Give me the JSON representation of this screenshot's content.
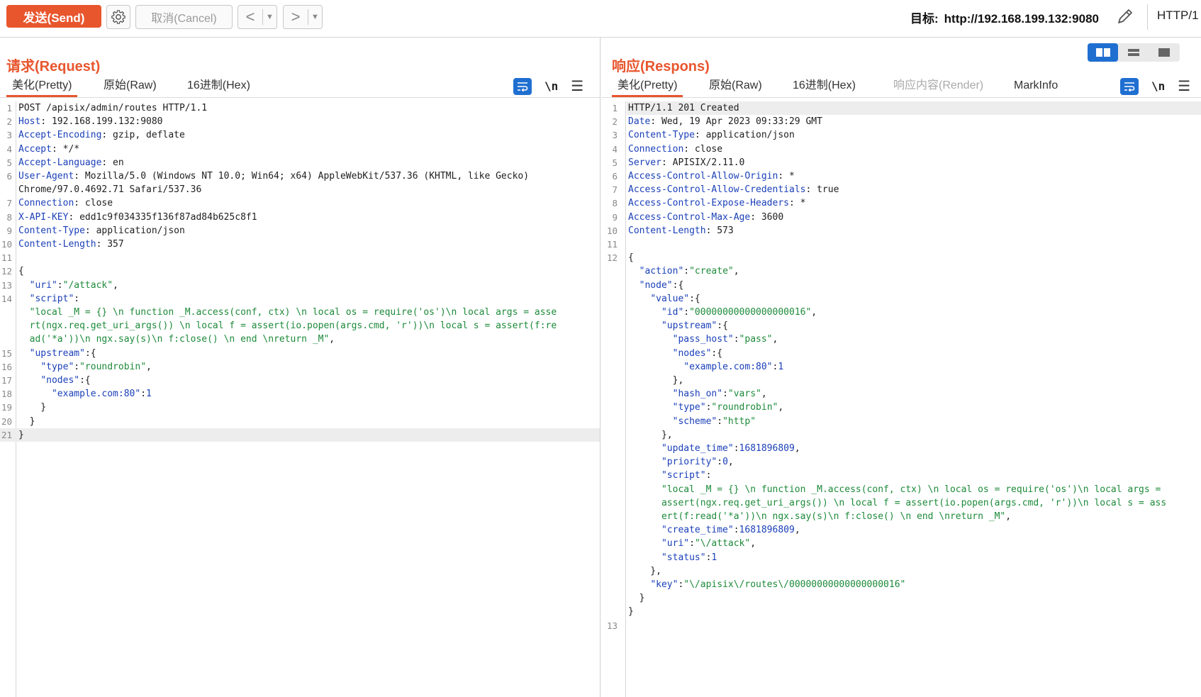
{
  "toolbar": {
    "send_label": "发送(Send)",
    "cancel_label": "取消(Cancel)",
    "back_arrow": "<",
    "forward_arrow": ">",
    "dropdown_glyph": "▼",
    "target_label": "目标:",
    "target_url": "http://192.168.199.132:9080",
    "http_version": "HTTP/1",
    "icons": [
      "gear-icon",
      "pencil-icon"
    ]
  },
  "request": {
    "title": "请求(Request)",
    "tabs": [
      "美化(Pretty)",
      "原始(Raw)",
      "16进制(Hex)"
    ],
    "active_tab": 0,
    "newline_label": "\\n"
  },
  "response": {
    "title": "响应(Respons)",
    "tabs": [
      "美化(Pretty)",
      "原始(Raw)",
      "16进制(Hex)",
      "响应内容(Render)",
      "MarkInfo"
    ],
    "active_tab": 0,
    "disabled_tabs": [
      3
    ],
    "newline_label": "\\n"
  },
  "colors": {
    "accent": "#e8562e",
    "primary": "#1f6fd1",
    "header_key": "#1a3fb8",
    "string": "#1d8a3a"
  }
}
